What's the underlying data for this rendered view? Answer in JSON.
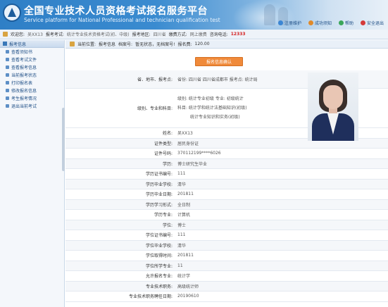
{
  "header": {
    "title_cn": "全国专业技术人员资格考试报名服务平台",
    "title_en": "Service platform for National Professional and technician qualification test",
    "links": [
      "注册维护",
      "成功须知",
      "帮助",
      "安全退出"
    ]
  },
  "infobar": {
    "welcome_label": "欢迎您:",
    "user_name": "吴XX13",
    "exam_label": "报考考试:",
    "exam_value": "统计专业技术资格考试(初、中级)",
    "area_label": "报考地区:",
    "area_value": "四川省",
    "mode_label": "缴费方式:",
    "mode_value": "网上缴费",
    "phone_label": "咨询电话:",
    "phone_value": "12333"
  },
  "sidebar": {
    "header": "报考信息",
    "items": [
      "查看须知书",
      "查看考试文件",
      "查看报考信息",
      "当前报考状态",
      "打印报名表",
      "修改报名信息",
      "考生报考情况",
      "退出当前考试"
    ]
  },
  "location": {
    "label": "当前位置:",
    "path": "报考信息",
    "status_label": "档案号:",
    "status_value": "暂无状态，无档案号!",
    "fee_label": "报名费:",
    "fee_value": "120.00"
  },
  "confirm_button": "报名信息确认",
  "form": {
    "region_label": "省、地市、报考点:",
    "region_value": "省份: 四川省   四川省成都市   报考点: 统计局",
    "subject_label": "级别、专业和科目:",
    "subject_lines": [
      "级别: 统计专业初级   专业: 初级统计",
      "科目: 统计学和统计法基础知识(初级)",
      "统计专业知识和实务(初级)"
    ],
    "fields": [
      {
        "label": "姓名:",
        "value": "吴XX13"
      },
      {
        "label": "证件类型:",
        "value": "居民身份证"
      },
      {
        "label": "证件号码:",
        "value": "370112199****6026"
      },
      {
        "label": "学历:",
        "value": "博士研究生毕业"
      },
      {
        "label": "学历证书编号:",
        "value": "111"
      },
      {
        "label": "学历毕业学校:",
        "value": "清华"
      },
      {
        "label": "学历毕业日期:",
        "value": "201811"
      },
      {
        "label": "学历学习形式:",
        "value": "全日制"
      },
      {
        "label": "学历专业:",
        "value": "计算机"
      },
      {
        "label": "学位:",
        "value": "博士"
      },
      {
        "label": "学位证书编号:",
        "value": "111"
      },
      {
        "label": "学位毕业学校:",
        "value": "清华"
      },
      {
        "label": "学位取得时间:",
        "value": "201811"
      },
      {
        "label": "学位所学专业:",
        "value": "11"
      },
      {
        "label": "允许报名专业:",
        "value": "统计学"
      },
      {
        "label": "专业技术职务:",
        "value": "高级统计师"
      },
      {
        "label": "专业技术职务聘任日期:",
        "value": "20190610"
      }
    ]
  }
}
